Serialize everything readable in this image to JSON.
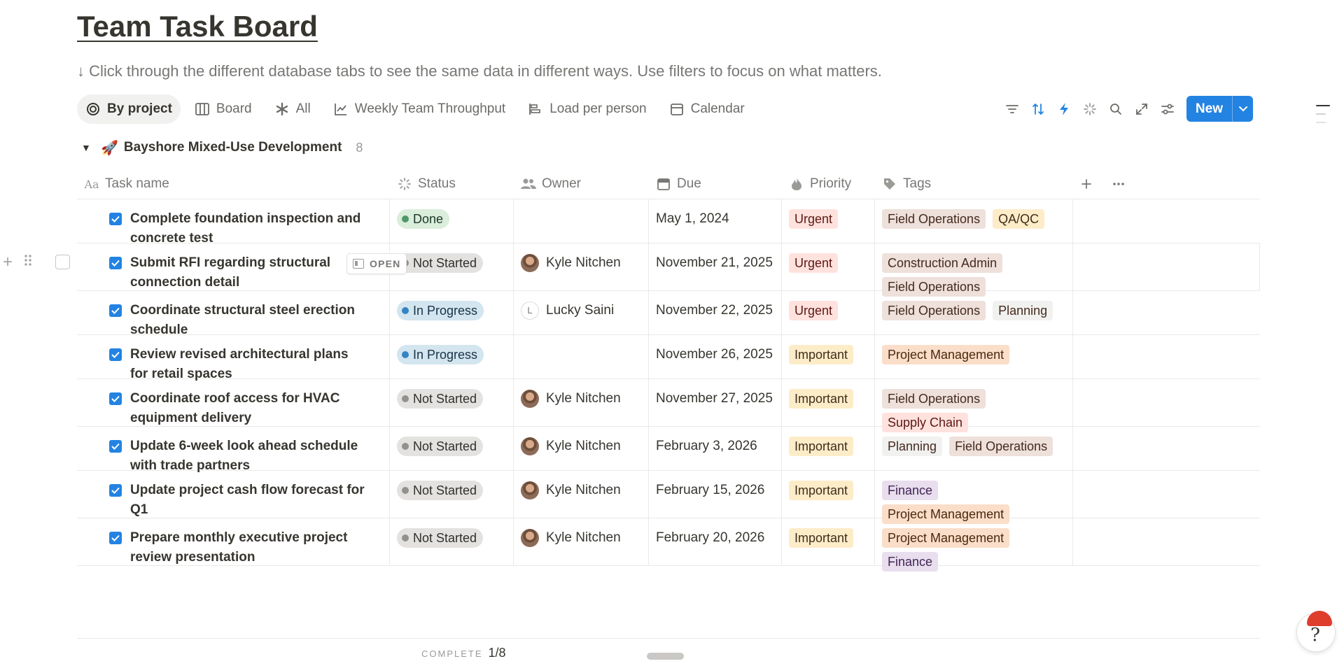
{
  "page": {
    "title": "Team Task Board",
    "subtitle": "↓ Click through the different database tabs to see the same data in different ways. Use filters to focus on what matters."
  },
  "tabs": [
    {
      "label": "By project",
      "icon": "target-icon",
      "active": true
    },
    {
      "label": "Board",
      "icon": "board-columns-icon"
    },
    {
      "label": "All",
      "icon": "asterisk-icon"
    },
    {
      "label": "Weekly Team Throughput",
      "icon": "line-chart-icon"
    },
    {
      "label": "Load per person",
      "icon": "bar-chart-icon"
    },
    {
      "label": "Calendar",
      "icon": "calendar-icon"
    }
  ],
  "toolbar": {
    "icons": [
      "filter-icon",
      "sort-icon",
      "automation-bolt-icon",
      "loading-spinner-icon",
      "search-icon",
      "expand-icon",
      "settings-sliders-icon"
    ],
    "new_label": "New"
  },
  "group": {
    "emoji": "🚀",
    "name": "Bayshore Mixed-Use Development",
    "count": "8"
  },
  "columns": {
    "name": "Task name",
    "status": "Status",
    "owner": "Owner",
    "due": "Due",
    "priority": "Priority",
    "tags": "Tags"
  },
  "row_actions": {
    "open_label": "OPEN"
  },
  "rows": [
    {
      "name": "Complete foundation inspection and concrete test",
      "status": "Done",
      "owner": "",
      "due": "May 1, 2024",
      "priority": "Urgent",
      "tags": [
        "Field Operations",
        "QA/QC"
      ]
    },
    {
      "name": "Submit RFI regarding structural connection detail",
      "status": "Not Started",
      "owner": "Kyle Nitchen",
      "due": "November 21, 2025",
      "priority": "Urgent",
      "tags": [
        "Construction Admin",
        "Field Operations"
      ]
    },
    {
      "name": "Coordinate structural steel erection schedule",
      "status": "In Progress",
      "owner": "Lucky Saini",
      "owner_initial": "L",
      "due": "November 22, 2025",
      "priority": "Urgent",
      "tags": [
        "Field Operations",
        "Planning"
      ]
    },
    {
      "name": "Review revised architectural plans for retail spaces",
      "status": "In Progress",
      "owner": "",
      "due": "November 26, 2025",
      "priority": "Important",
      "tags": [
        "Project Management"
      ]
    },
    {
      "name": "Coordinate roof access for HVAC equipment delivery",
      "status": "Not Started",
      "owner": "Kyle Nitchen",
      "due": "November 27, 2025",
      "priority": "Important",
      "tags": [
        "Field Operations",
        "Supply Chain"
      ]
    },
    {
      "name": "Update 6-week look ahead schedule with trade partners",
      "status": "Not Started",
      "owner": "Kyle Nitchen",
      "due": "February 3, 2026",
      "priority": "Important",
      "tags": [
        "Planning",
        "Field Operations"
      ]
    },
    {
      "name": "Update project cash flow forecast for Q1",
      "status": "Not Started",
      "owner": "Kyle Nitchen",
      "due": "February 15, 2026",
      "priority": "Important",
      "tags": [
        "Finance",
        "Project Management"
      ]
    },
    {
      "name": "Prepare monthly executive project review presentation",
      "status": "Not Started",
      "owner": "Kyle Nitchen",
      "due": "February 20, 2026",
      "priority": "Important",
      "tags": [
        "Project Management",
        "Finance"
      ]
    }
  ],
  "footer": {
    "calc_label": "COMPLETE",
    "calc_value": "1/8"
  },
  "colors": {
    "accent": "#2383e2",
    "urgent_bg": "#ffe2dd",
    "urgent_fg": "#5d1715",
    "important_bg": "#fdecc8",
    "important_fg": "#402c1b",
    "tag_field_operations": "#eee0da",
    "tag_qaqc": "#fdecc8",
    "tag_construction_admin": "#eee0da",
    "tag_planning": "#f1f1ef",
    "tag_project_management": "#fadec9",
    "tag_supply_chain": "#ffe2dd",
    "tag_finance": "#e8deee"
  }
}
